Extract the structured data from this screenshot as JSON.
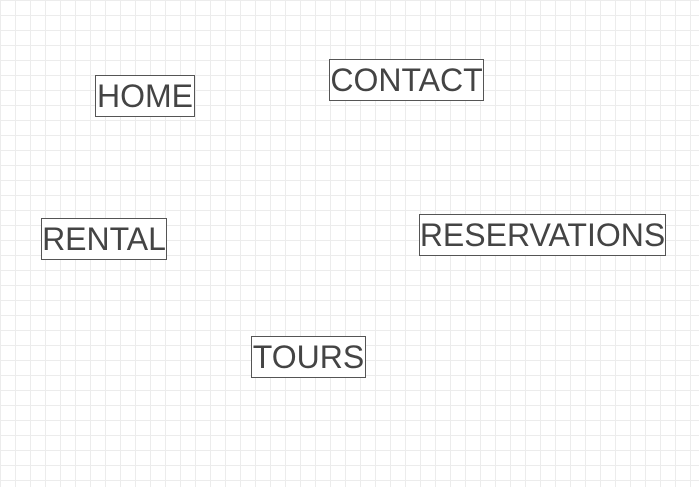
{
  "diagram": {
    "nodes": [
      {
        "id": "home",
        "label": "HOME"
      },
      {
        "id": "contact",
        "label": "CONTACT"
      },
      {
        "id": "rental",
        "label": "RENTAL"
      },
      {
        "id": "reservations",
        "label": "RESERVATIONS"
      },
      {
        "id": "tours",
        "label": "TOURS"
      }
    ],
    "colors": {
      "text": "#444444",
      "border": "#555555",
      "grid": "#ececec",
      "background": "#ffffff"
    }
  }
}
